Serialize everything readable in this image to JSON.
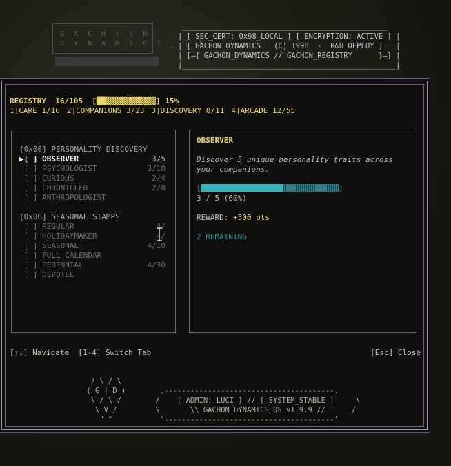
{
  "background": {
    "logo": "G A C H ( ) N\nD Y N A M I C S _ [ ]",
    "header_ascii": " _______________________________________________\n| [ SEC_CERT: 0x98_LOCAL ] [ ENCRYPTION: ACTIVE ] |\n| [ GACHON DYNAMICS   (C) 1998  -  R&D DEPLOY ]   |\n| [—{ GACHON_DYNAMICS // GACHON_REGISTRY      }—] |\n|_________________________________________________|"
  },
  "registry": {
    "label": "REGISTRY",
    "count": "16/105",
    "bar_open": "[",
    "bar_filled": "██▓▓▓▓▓▓▓▓▓▓▓",
    "bar_close": "]",
    "percent": "15%"
  },
  "tabs": [
    {
      "label": "1]CARE 1/16"
    },
    {
      "label": "2]COMPANIONS 3/23"
    },
    {
      "label": "3]DISCOVERY 0/11"
    },
    {
      "label": "4]ARCADE 12/55"
    }
  ],
  "groups": [
    {
      "title": "[0x00] PERSONALITY DISCOVERY",
      "items": [
        {
          "label": "▶[ ] OBSERVER",
          "count": "3/5",
          "selected": true
        },
        {
          "label": " [ ] PSYCHOLOGIST",
          "count": "3/10"
        },
        {
          "label": " [ ] CURIOUS",
          "count": "2/4"
        },
        {
          "label": " [ ] CHRONICLER",
          "count": "2/8"
        },
        {
          "label": " [ ] ANTHROPOLOGIST",
          "count": ""
        }
      ]
    },
    {
      "title": "[0x06] SEASONAL STAMPS",
      "items": [
        {
          "label": " [ ] REGULAR",
          "count": "4/"
        },
        {
          "label": " [ ] HOLIDAYMAKER",
          "count": "4/"
        },
        {
          "label": " [ ] SEASONAL",
          "count": "4/10"
        },
        {
          "label": " [ ] FULL CALENDAR",
          "count": ""
        },
        {
          "label": " [ ] PERENNIAL",
          "count": "4/30"
        },
        {
          "label": " [ ] DEVOTEE",
          "count": ""
        }
      ]
    }
  ],
  "detail": {
    "title": "OBSERVER",
    "description": "Discover 5 unique personality traits across your companions.",
    "bar_open": "[",
    "bar_close": "]",
    "progress_fraction": 0.6,
    "progress_text": "3 / 5 (60%)",
    "reward_label": "REWARD: ",
    "reward_value": "+500 pts",
    "remaining": "2 REMAINING"
  },
  "footer": {
    "hint_left": "[↑↓] Navigate  [1-4] Switch Tab",
    "hint_right": "[Esc] Close"
  },
  "art": {
    "emblem": "  / \\ / \\\n ( G | D )\n  \\ / \\ /\n   \\ V /\n    \" \"",
    "admin_box": "  .---------------------------------------.\n /    [ ADMIN: LUCI ] // [ SYSTEM_STABLE ]     \\\n \\       \\\\ GACHON_DYNAMICS_OS_v1.9.9 //      /\n  '---------------------------------------'"
  },
  "colors": {
    "accent_yellow": "#ead36a",
    "accent_cyan": "#3cb0bc",
    "border_purple": "#a892b8"
  }
}
